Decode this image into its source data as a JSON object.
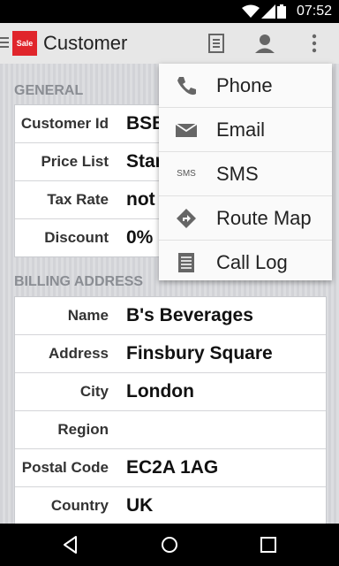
{
  "status_bar": {
    "time": "07:52"
  },
  "app_bar": {
    "logo_text": "Sale",
    "title": "Customer",
    "actions": [
      "document-icon",
      "contact-icon",
      "overflow-menu-icon"
    ]
  },
  "general": {
    "heading": "GENERAL",
    "rows": [
      {
        "label": "Customer Id",
        "value": "BSB"
      },
      {
        "label": "Price List",
        "value": "Standard"
      },
      {
        "label": "Tax Rate",
        "value": "not"
      },
      {
        "label": "Discount",
        "value": "0%"
      }
    ]
  },
  "billing": {
    "heading": "BILLING ADDRESS",
    "rows": [
      {
        "label": "Name",
        "value": "B's Beverages"
      },
      {
        "label": "Address",
        "value": "Finsbury Square"
      },
      {
        "label": "City",
        "value": "London"
      },
      {
        "label": "Region",
        "value": ""
      },
      {
        "label": "Postal Code",
        "value": "EC2A 1AG"
      },
      {
        "label": "Country",
        "value": "UK"
      }
    ]
  },
  "menu": {
    "items": [
      {
        "label": "Phone",
        "icon": "phone-icon"
      },
      {
        "label": "Email",
        "icon": "email-icon"
      },
      {
        "label": "SMS",
        "icon": "sms-icon",
        "icon_text": "SMS"
      },
      {
        "label": "Route Map",
        "icon": "directions-icon"
      },
      {
        "label": "Call Log",
        "icon": "list-icon"
      }
    ]
  }
}
